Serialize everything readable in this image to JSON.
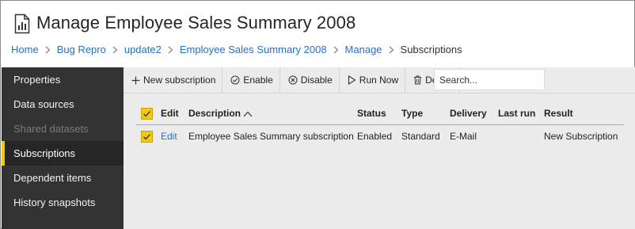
{
  "header": {
    "title": "Manage Employee Sales Summary 2008",
    "icon": "report-icon"
  },
  "breadcrumb": {
    "items": [
      "Home",
      "Bug Repro",
      "update2",
      "Employee Sales Summary 2008",
      "Manage"
    ],
    "current": "Subscriptions"
  },
  "sidebar": {
    "items": [
      {
        "label": "Properties",
        "state": "normal"
      },
      {
        "label": "Data sources",
        "state": "normal"
      },
      {
        "label": "Shared datasets",
        "state": "disabled"
      },
      {
        "label": "Subscriptions",
        "state": "active"
      },
      {
        "label": "Dependent items",
        "state": "normal"
      },
      {
        "label": "History snapshots",
        "state": "normal"
      }
    ]
  },
  "toolbar": {
    "new_subscription": "New subscription",
    "enable": "Enable",
    "disable": "Disable",
    "run_now": "Run Now",
    "delete": "Delete",
    "search_placeholder": "Search..."
  },
  "table": {
    "columns": [
      "Edit",
      "Description",
      "Status",
      "Type",
      "Delivery",
      "Last run",
      "Result"
    ],
    "sort_indicator": "chevron-up-icon",
    "rows": [
      {
        "checked": true,
        "edit": "Edit",
        "description": "Employee Sales Summary subscription",
        "status": "Enabled",
        "type": "Standard",
        "delivery": "E-Mail",
        "last_run": "",
        "result": "New Subscription"
      }
    ]
  },
  "colors": {
    "accent": "#f2c811",
    "link": "#2a6fc0",
    "sidebar_bg": "#333333",
    "content_bg": "#ececec"
  }
}
